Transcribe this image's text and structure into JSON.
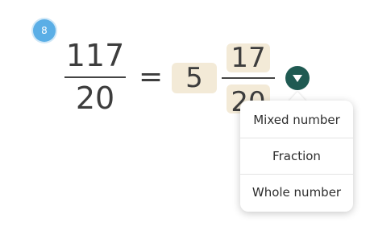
{
  "question_number": "8",
  "equation": {
    "lhs_numerator": "117",
    "lhs_denominator": "20",
    "operator": "=",
    "whole_answer": "5",
    "numerator_answer": "17",
    "denominator_answer": "20"
  },
  "dropdown": {
    "icon": "chevron-down-icon",
    "options": [
      "Mixed number",
      "Fraction",
      "Whole number"
    ]
  },
  "colors": {
    "badge": "#5aaee6",
    "answer_box": "#f3ead7",
    "toggle": "#1f5a52"
  }
}
